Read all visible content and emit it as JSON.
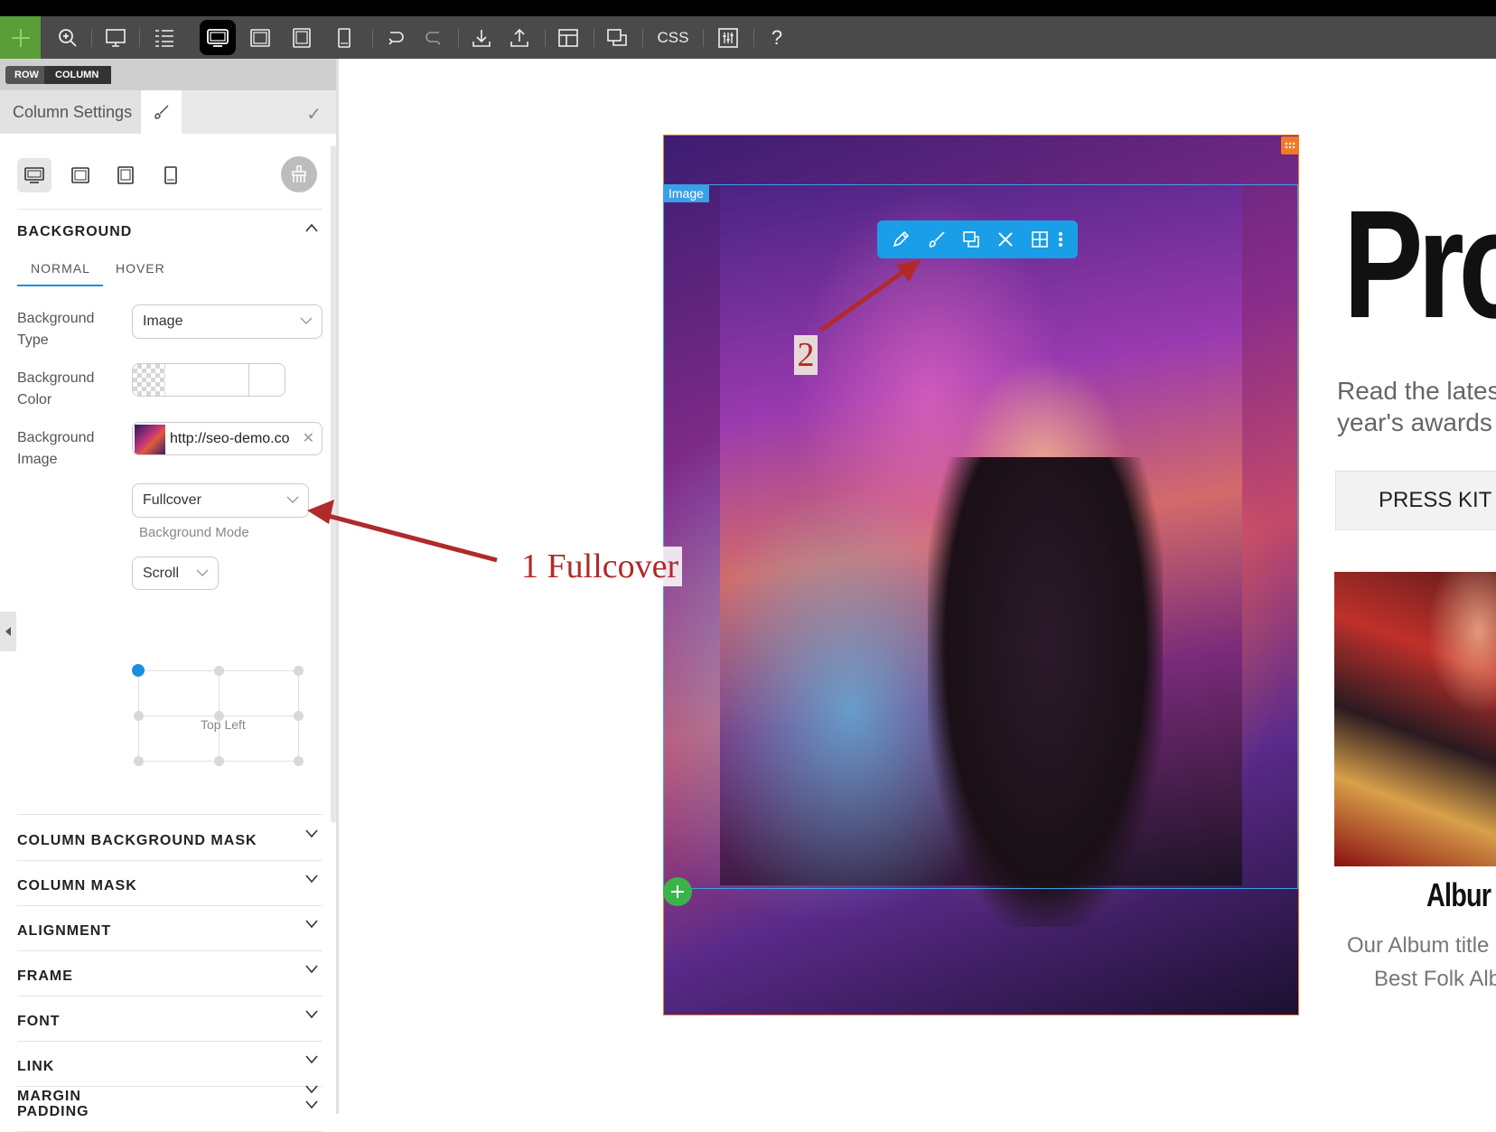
{
  "toolbar": {
    "css_label": "CSS",
    "help_label": "?",
    "icons": [
      "plus-icon",
      "zoom-icon",
      "desktop-icon",
      "layers-icon",
      "desktop-view-icon",
      "laptop-view-icon",
      "tablet-view-icon",
      "mobile-view-icon",
      "undo-icon",
      "redo-icon",
      "import-icon",
      "export-icon",
      "layout-icon",
      "duplicate-icon",
      "css-icon",
      "custom-code-icon",
      "help-icon"
    ]
  },
  "breadcrumb": {
    "row": "ROW",
    "column": "COLUMN"
  },
  "panel": {
    "title": "Column Settings",
    "check": "✓",
    "background": {
      "title": "BACKGROUND",
      "tabs": {
        "normal": "NORMAL",
        "hover": "HOVER",
        "active": "normal"
      },
      "type_label": "Background Type",
      "type_value": "Image",
      "color_label": "Background Color",
      "image_label": "Background Image",
      "image_url": "http://seo-demo.co",
      "mode_value": "Fullcover",
      "mode_hint": "Background Mode",
      "attachment_value": "Scroll",
      "position_value": "Top Left"
    },
    "sections": [
      "COLUMN BACKGROUND MASK",
      "COLUMN MASK",
      "ALIGNMENT",
      "FRAME",
      "FONT",
      "LINK",
      "PADDING",
      "MARGIN"
    ]
  },
  "canvas": {
    "image_tag": "Image",
    "annotation_1": "1 Fullcover",
    "annotation_2": "2",
    "heading": "Pro",
    "para_line1": "Read the lates",
    "para_line2": "year's awards",
    "press_button": "PRESS KIT",
    "album_title": "Albur",
    "album_sub1": "Our Album title",
    "album_sub2": "Best Folk Alb"
  },
  "colors": {
    "accent_blue": "#1a9ee8",
    "annotation_red": "#b02a2a",
    "column_outline": "#f07a2a",
    "add_green": "#3ab34a"
  }
}
